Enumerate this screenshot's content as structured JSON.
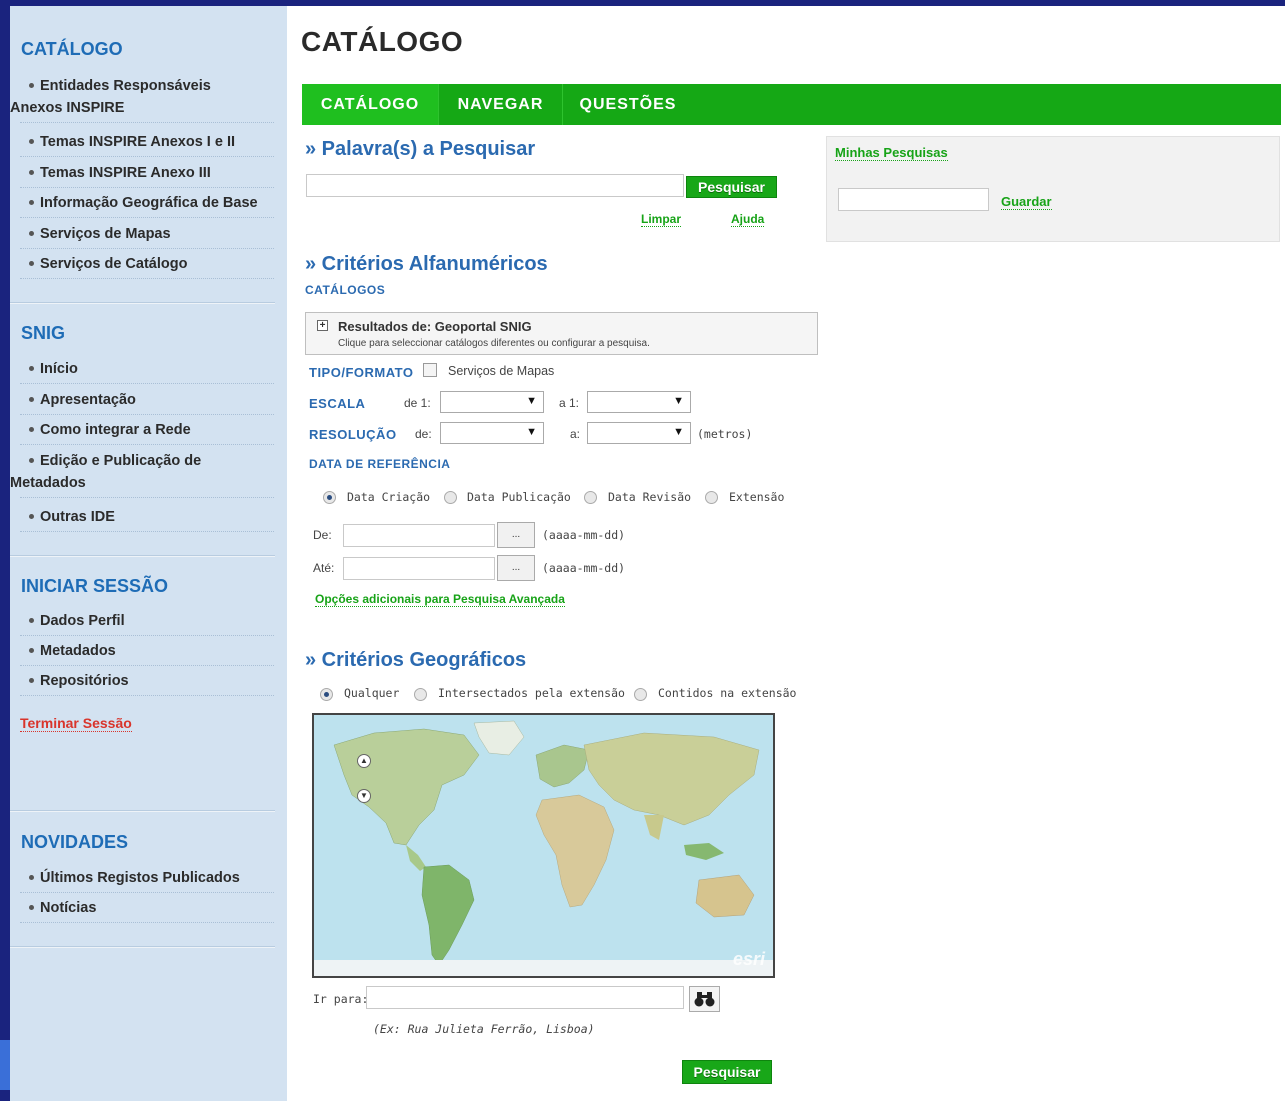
{
  "sidebar": {
    "catalogo": {
      "title": "CATÁLOGO",
      "items": [
        {
          "label": "Entidades Responsáveis",
          "label2": "Anexos INSPIRE"
        },
        {
          "label": "Temas INSPIRE Anexos I e II"
        },
        {
          "label": "Temas INSPIRE Anexo III"
        },
        {
          "label": "Informação Geográfica de Base"
        },
        {
          "label": "Serviços de Mapas"
        },
        {
          "label": "Serviços de Catálogo"
        }
      ]
    },
    "snig": {
      "title": "SNIG",
      "items": [
        {
          "label": "Início"
        },
        {
          "label": "Apresentação"
        },
        {
          "label": "Como integrar a Rede"
        },
        {
          "label": "Edição e Publicação de",
          "label2": "Metadados"
        },
        {
          "label": "Outras IDE"
        }
      ]
    },
    "sessao": {
      "title": "INICIAR SESSÃO",
      "items": [
        {
          "label": "Dados Perfil"
        },
        {
          "label": "Metadados"
        },
        {
          "label": "Repositórios"
        }
      ],
      "logout": "Terminar Sessão"
    },
    "novidades": {
      "title": "NOVIDADES",
      "items": [
        {
          "label": "Últimos Registos Publicados"
        },
        {
          "label": "Notícias"
        }
      ]
    }
  },
  "main": {
    "title": "CATÁLOGO",
    "tabs": [
      {
        "label": "CATÁLOGO"
      },
      {
        "label": "NAVEGAR"
      },
      {
        "label": "QUESTÕES"
      }
    ],
    "search": {
      "heading": "» Palavra(s) a Pesquisar",
      "value": "",
      "button": "Pesquisar",
      "clear": "Limpar",
      "help": "Ajuda"
    },
    "saved": {
      "title": "Minhas Pesquisas",
      "value": "",
      "save": "Guardar"
    },
    "alfa": {
      "heading": "» Critérios Alfanuméricos",
      "catalogs_label": "CATÁLOGOS",
      "results_title": "Resultados de: Geoportal SNIG",
      "results_sub": "Clique para seleccionar catálogos diferentes ou configurar a pesquisa.",
      "tipo_label": "TIPO/FORMATO",
      "tipo_option": "Serviços de Mapas",
      "escala_label": "ESCALA",
      "escala_de": "de 1:",
      "escala_a": "a 1:",
      "resolucao_label": "RESOLUÇÃO",
      "res_de": "de:",
      "res_a": "a:",
      "res_unit": "(metros)",
      "data_label": "DATA DE REFERÊNCIA",
      "date_types": [
        "Data Criação",
        "Data Publicação",
        "Data Revisão",
        "Extensão"
      ],
      "de_label": "De:",
      "ate_label": "Até:",
      "date_fmt": "(aaaa-mm-dd)",
      "dots": "...",
      "advanced": "Opções adicionais para Pesquisa Avançada"
    },
    "geo": {
      "heading": "» Critérios Geográficos",
      "options": [
        "Qualquer",
        "Intersectados pela extensão",
        "Contidos na extensão"
      ],
      "map_credit": "esri",
      "goto_label": "Ir para:",
      "goto_value": "",
      "example": "(Ex: Rua Julieta Ferrão, Lisboa)",
      "button": "Pesquisar"
    }
  }
}
